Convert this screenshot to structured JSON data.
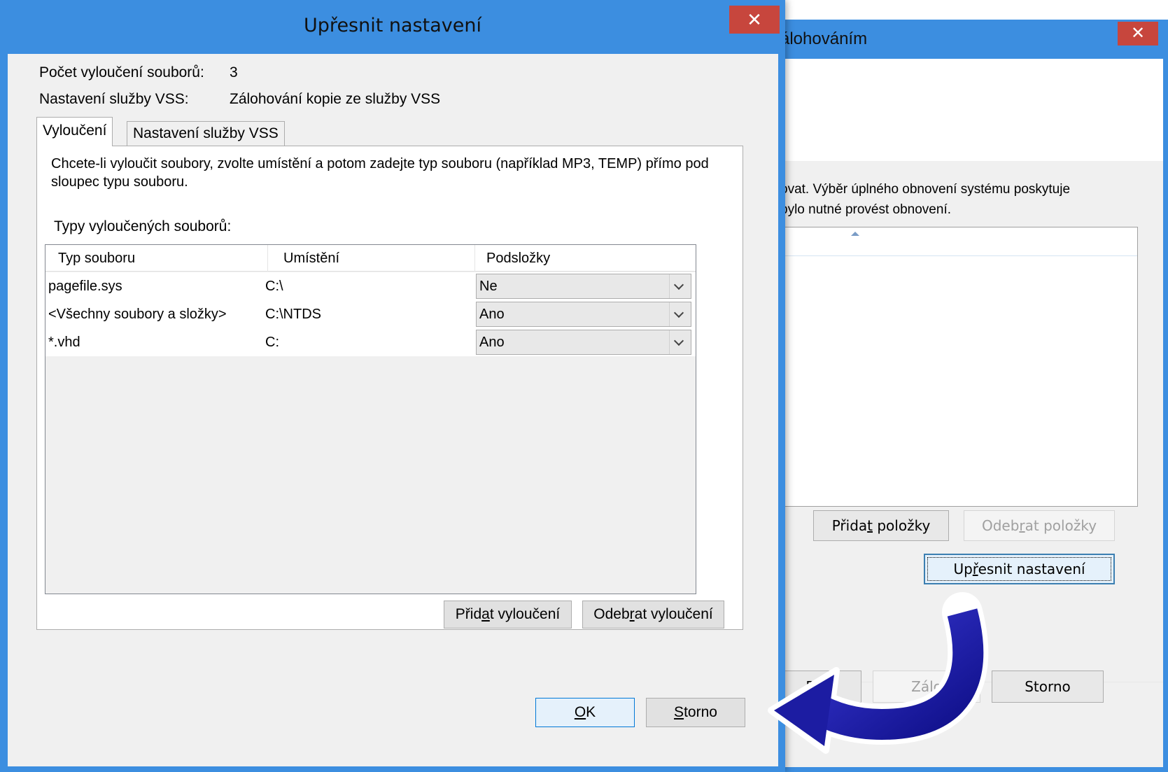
{
  "back_window": {
    "title": "álohováním",
    "close_glyph": "✕",
    "description_line1": "ovat. Výběr úplného obnovení systému poskytuje",
    "description_line2": "bylo nutné provést obnovení.",
    "link_text": "/",
    "buttons": {
      "add_items": {
        "pre": "Přida",
        "mn": "t",
        "post": " položky"
      },
      "remove_items": {
        "pre": "Odeb",
        "mn": "r",
        "post": "at položky"
      },
      "advanced": {
        "pre": "Up",
        "mn": "ř",
        "post": "esnit nastavení"
      },
      "next_partial": "Dal",
      "backup_partial": "Zálo",
      "cancel": "Storno"
    }
  },
  "dialog": {
    "title": "Upřesnit nastavení",
    "close_glyph": "✕",
    "exclusions_count_label": "Počet vyloučení souborů:",
    "exclusions_count_value": "3",
    "vss_label": "Nastavení služby VSS:",
    "vss_value": "Zálohování kopie ze služby VSS",
    "tabs": [
      {
        "label": "Vyloučení",
        "active": true
      },
      {
        "label": "Nastavení služby VSS",
        "active": false
      }
    ],
    "panel_text": "Chcete-li vyloučit soubory, zvolte umístění a potom zadejte typ souboru (například MP3, TEMP) přímo pod sloupec typu souboru.",
    "grid_title": "Typy vyloučených souborů:",
    "columns": [
      "Typ souboru",
      "Umístění",
      "Podsložky"
    ],
    "rows": [
      {
        "type": "pagefile.sys",
        "location": "C:\\",
        "subfolders": "Ne"
      },
      {
        "type": "<Všechny soubory a složky>",
        "location": "C:\\NTDS",
        "subfolders": "Ano"
      },
      {
        "type": "*.vhd",
        "location": "C:",
        "subfolders": "Ano"
      }
    ],
    "add_exclusion": {
      "pre": "Přid",
      "mn": "a",
      "post": "t vyloučení"
    },
    "remove_exclusion": {
      "pre": "Odeb",
      "mn": "r",
      "post": "at vyloučení"
    },
    "ok": {
      "pre": "",
      "mn": "O",
      "post": "K"
    },
    "cancel": {
      "pre": "",
      "mn": "S",
      "post": "torno"
    }
  },
  "colors": {
    "window_frame": "#3c8ee0",
    "close_button": "#c7463d",
    "arrow": "#1f1fa8"
  }
}
